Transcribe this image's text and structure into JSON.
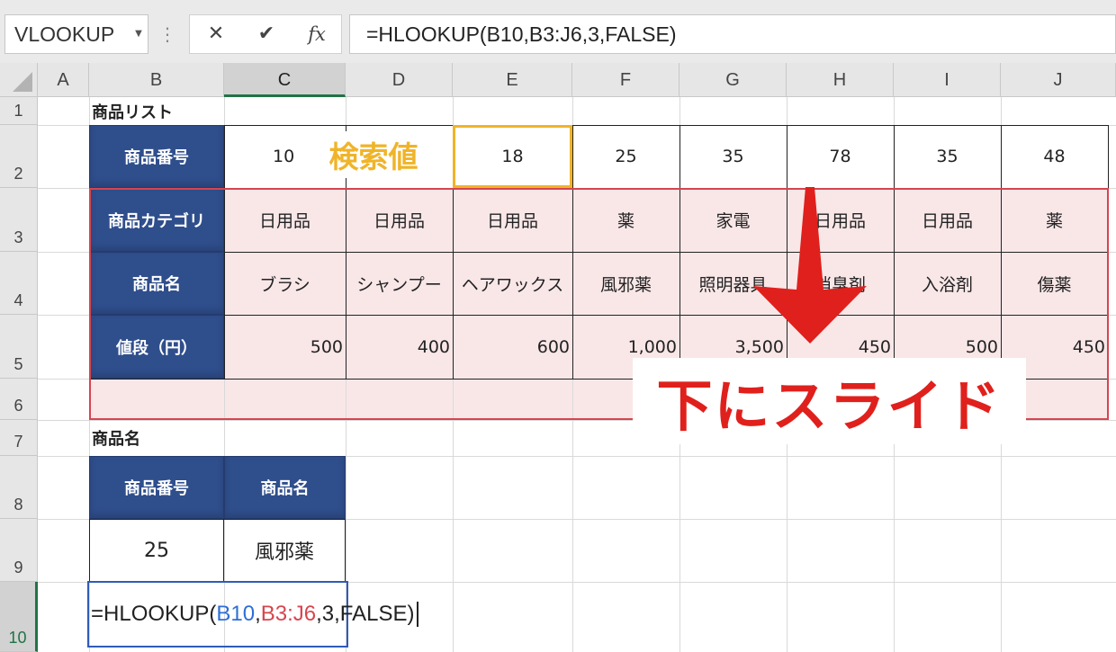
{
  "formula_bar": {
    "name_box": "VLOOKUP",
    "cancel_icon": "✕",
    "enter_icon": "✔",
    "fx_label": "fx",
    "formula": "=HLOOKUP(B10,B3:J6,3,FALSE)"
  },
  "columns": [
    "A",
    "B",
    "C",
    "D",
    "E",
    "F",
    "G",
    "H",
    "I",
    "J"
  ],
  "rows": [
    "1",
    "2",
    "3",
    "4",
    "5",
    "6",
    "7",
    "8",
    "9",
    "10"
  ],
  "table": {
    "title": "商品リスト",
    "row_headers": [
      "商品番号",
      "商品カテゴリ",
      "商品名",
      "値段（円）"
    ],
    "product_numbers": [
      "10",
      "18",
      "25",
      "35",
      "78",
      "35",
      "48"
    ],
    "categories": [
      "日用品",
      "日用品",
      "日用品",
      "薬",
      "家電",
      "日用品",
      "日用品",
      "薬"
    ],
    "product_names": [
      "ブラシ",
      "シャンプー",
      "ヘアワックス",
      "風邪薬",
      "照明器具",
      "消臭剤",
      "入浴剤",
      "傷薬"
    ],
    "prices": [
      "500",
      "400",
      "600",
      "1,000",
      "3,500",
      "450",
      "500",
      "450"
    ]
  },
  "annotations": {
    "search_value": "検索値",
    "slide_down": "下にスライド"
  },
  "lookup": {
    "title": "商品名",
    "header_number": "商品番号",
    "header_name": "商品名",
    "value_number": "25",
    "value_name": "風邪薬"
  },
  "formula_cell": {
    "prefix": "=HLOOKUP(",
    "ref1": "B10",
    "comma1": ",",
    "ref2": "B3:J6",
    "suffix": ",3,FALSE)"
  },
  "colors": {
    "header_fill": "#2f4e8c",
    "highlight_fill": "#f9e7e8",
    "highlight_border": "#d6454f",
    "search_border": "#f0b429",
    "arrow": "#e0201c",
    "excel_green": "#217346"
  }
}
